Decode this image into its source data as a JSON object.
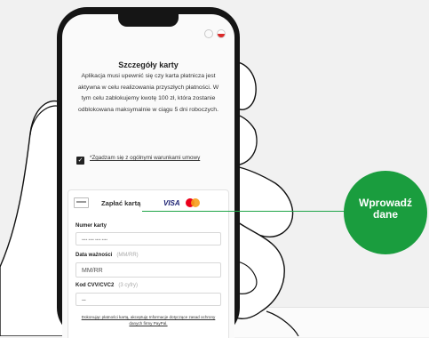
{
  "screen": {
    "title": "Szczegóły karty",
    "description": "Aplikacja musi upewnić się czy karta płatnicza jest aktywna w celu realizowania przyszłych płatności. W tym celu zablokujemy kwotę 100 zł, która zostanie odblokowana maksymalnie w ciągu 5 dni roboczych.",
    "consent": {
      "checked": true,
      "check_mark": "✓",
      "label": "*Zgadzam się z ogólnymi warunkami umowy"
    },
    "payment": {
      "title": "Zapłać kartą",
      "brands": [
        "VISA"
      ],
      "card_number": {
        "label": "Numer karty",
        "placeholder": "•••• •••• •••• ••••"
      },
      "expiry": {
        "label": "Data ważności",
        "hint": "(MM/RR)",
        "placeholder": "MM/RR"
      },
      "cvv": {
        "label": "Kod CVV/CVC2",
        "hint": "(3 cyfry)",
        "placeholder": "•••"
      },
      "footer": "Dokonując płatności kartą, akceptuję Informacje dotyczące zasad ochrony danych firmy PayPal."
    }
  },
  "callout": {
    "line1": "Wprowadź",
    "line2": "dane",
    "color": "#1a9d3e"
  },
  "icons": [
    "globe-icon",
    "flag-icon",
    "card-icon",
    "visa-logo",
    "mastercard-logo"
  ]
}
